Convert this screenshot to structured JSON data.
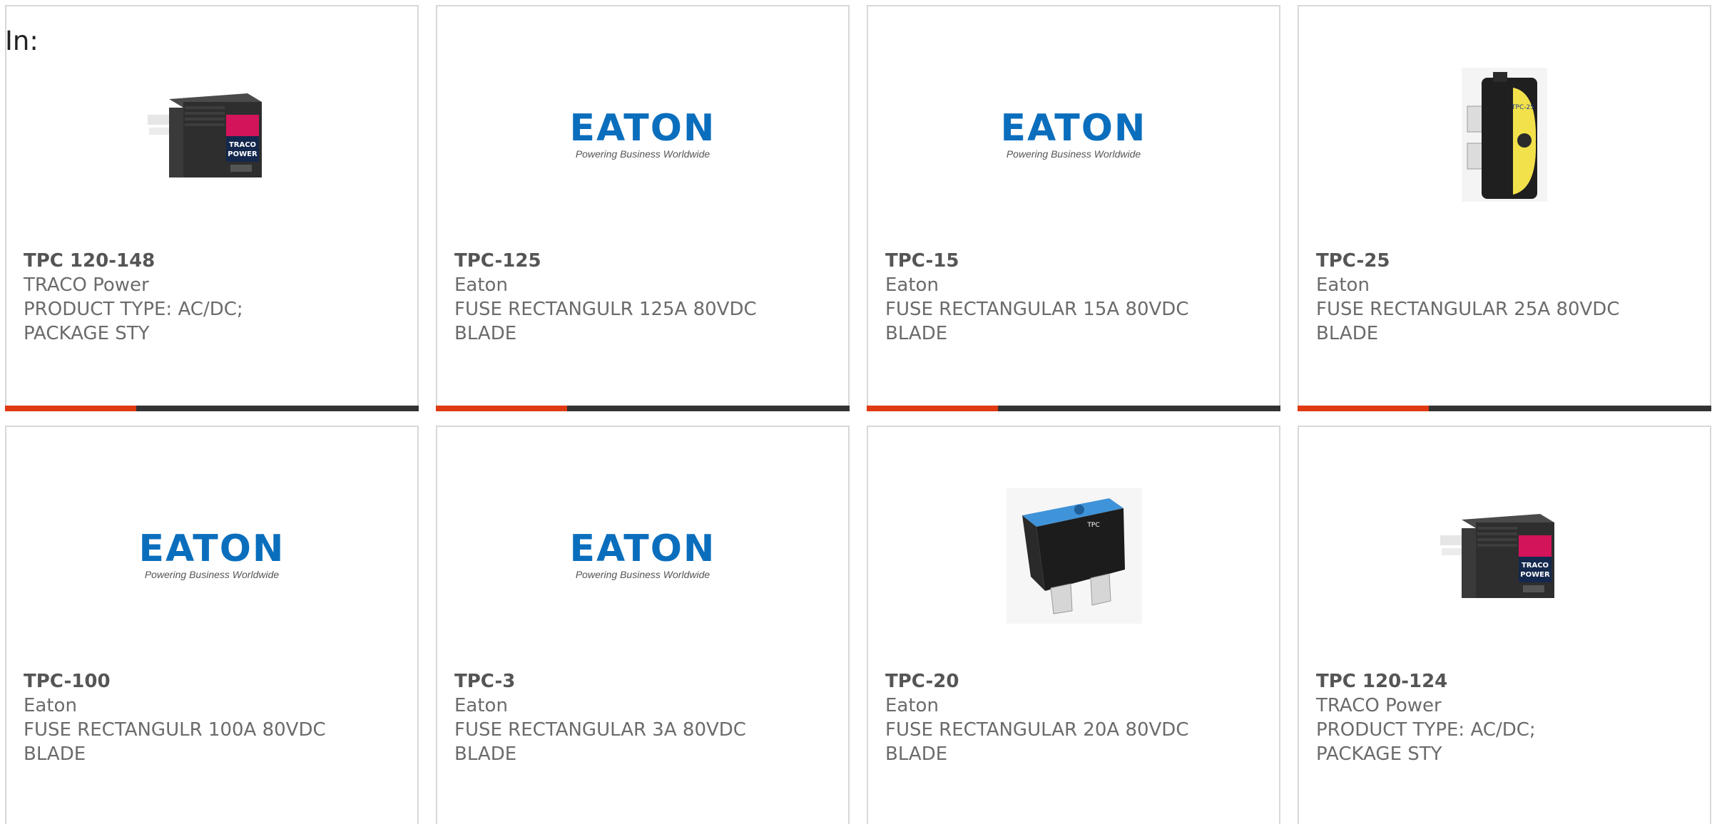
{
  "header": {
    "label": "In:"
  },
  "colors": {
    "accent": "#e03a12",
    "bar": "#333333",
    "eaton_blue": "#0a6ebd",
    "text": "#6b6b6b"
  },
  "products": [
    {
      "part": "TPC 120-148",
      "manufacturer": "TRACO Power",
      "description": "PRODUCT TYPE: AC/DC; PACKAGE STY",
      "image": "traco-power-supply"
    },
    {
      "part": "TPC-125",
      "manufacturer": "Eaton",
      "description": "FUSE RECTANGULR 125A 80VDC BLADE",
      "image": "eaton-logo"
    },
    {
      "part": "TPC-15",
      "manufacturer": "Eaton",
      "description": "FUSE RECTANGULAR 15A 80VDC BLADE",
      "image": "eaton-logo"
    },
    {
      "part": "TPC-25",
      "manufacturer": "Eaton",
      "description": "FUSE RECTANGULAR 25A 80VDC BLADE",
      "image": "yellow-fuse"
    },
    {
      "part": "TPC-100",
      "manufacturer": "Eaton",
      "description": "FUSE RECTANGULR 100A 80VDC BLADE",
      "image": "eaton-logo"
    },
    {
      "part": "TPC-3",
      "manufacturer": "Eaton",
      "description": "FUSE RECTANGULAR 3A 80VDC BLADE",
      "image": "eaton-logo"
    },
    {
      "part": "TPC-20",
      "manufacturer": "Eaton",
      "description": "FUSE RECTANGULAR 20A 80VDC BLADE",
      "image": "blue-fuse"
    },
    {
      "part": "TPC 120-124",
      "manufacturer": "TRACO Power",
      "description": "PRODUCT TYPE: AC/DC; PACKAGE STY",
      "image": "traco-power-supply"
    }
  ],
  "eaton_logo": {
    "word": "EATON",
    "tagline": "Powering Business Worldwide"
  },
  "traco_logo": {
    "line1": "TRACO",
    "line2": "POWER"
  },
  "fuse_labels": {
    "yellow": "TPC-25",
    "blue": "TPC"
  }
}
